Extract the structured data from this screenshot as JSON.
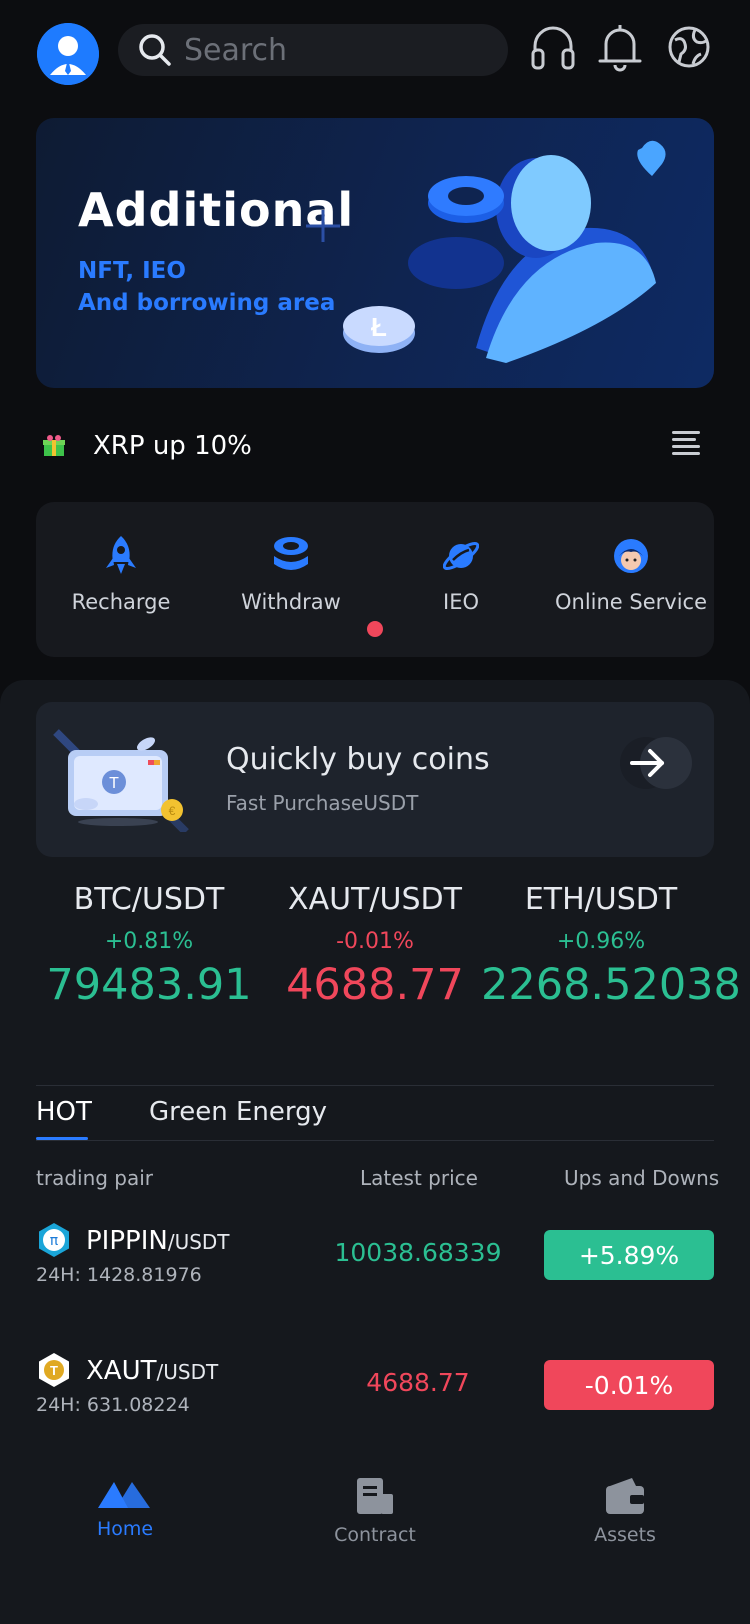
{
  "header": {
    "search_placeholder": "Search"
  },
  "banner": {
    "title": "Additional",
    "line1": "NFT, IEO",
    "line2": "And borrowing area"
  },
  "notice": {
    "text": "XRP up 10%"
  },
  "quick_actions": [
    {
      "label": "Recharge",
      "icon": "rocket-icon"
    },
    {
      "label": "Withdraw",
      "icon": "coins-icon"
    },
    {
      "label": "IEO",
      "icon": "planet-icon"
    },
    {
      "label": "Online Service",
      "icon": "agent-icon"
    }
  ],
  "buy_card": {
    "title": "Quickly buy coins",
    "subtitle": "Fast PurchaseUSDT"
  },
  "tickers": [
    {
      "pair": "BTC/USDT",
      "change": "+0.81%",
      "price": "79483.91",
      "trend": "up"
    },
    {
      "pair": "XAUT/USDT",
      "change": "-0.01%",
      "price": "4688.77",
      "trend": "down"
    },
    {
      "pair": "ETH/USDT",
      "change": "+0.96%",
      "price": "2268.52038",
      "trend": "up"
    }
  ],
  "tabs": [
    {
      "label": "HOT",
      "active": true
    },
    {
      "label": "Green Energy",
      "active": false
    }
  ],
  "table": {
    "headers": [
      "trading pair",
      "Latest price",
      "Ups and Downs"
    ],
    "rows": [
      {
        "base": "PIPPIN",
        "quote": "/USDT",
        "volume": "24H: 1428.81976",
        "price": "10038.68339",
        "change": "+5.89%",
        "trend": "up"
      },
      {
        "base": "XAUT",
        "quote": "/USDT",
        "volume": "24H: 631.08224",
        "price": "4688.77",
        "change": "-0.01%",
        "trend": "down"
      }
    ]
  },
  "nav": [
    {
      "label": "Home",
      "active": true
    },
    {
      "label": "Contract",
      "active": false
    },
    {
      "label": "Assets",
      "active": false
    }
  ],
  "colors": {
    "accent": "#2a7bff",
    "up": "#2bbf92",
    "down": "#f0475b",
    "background": "#0c0d10"
  }
}
